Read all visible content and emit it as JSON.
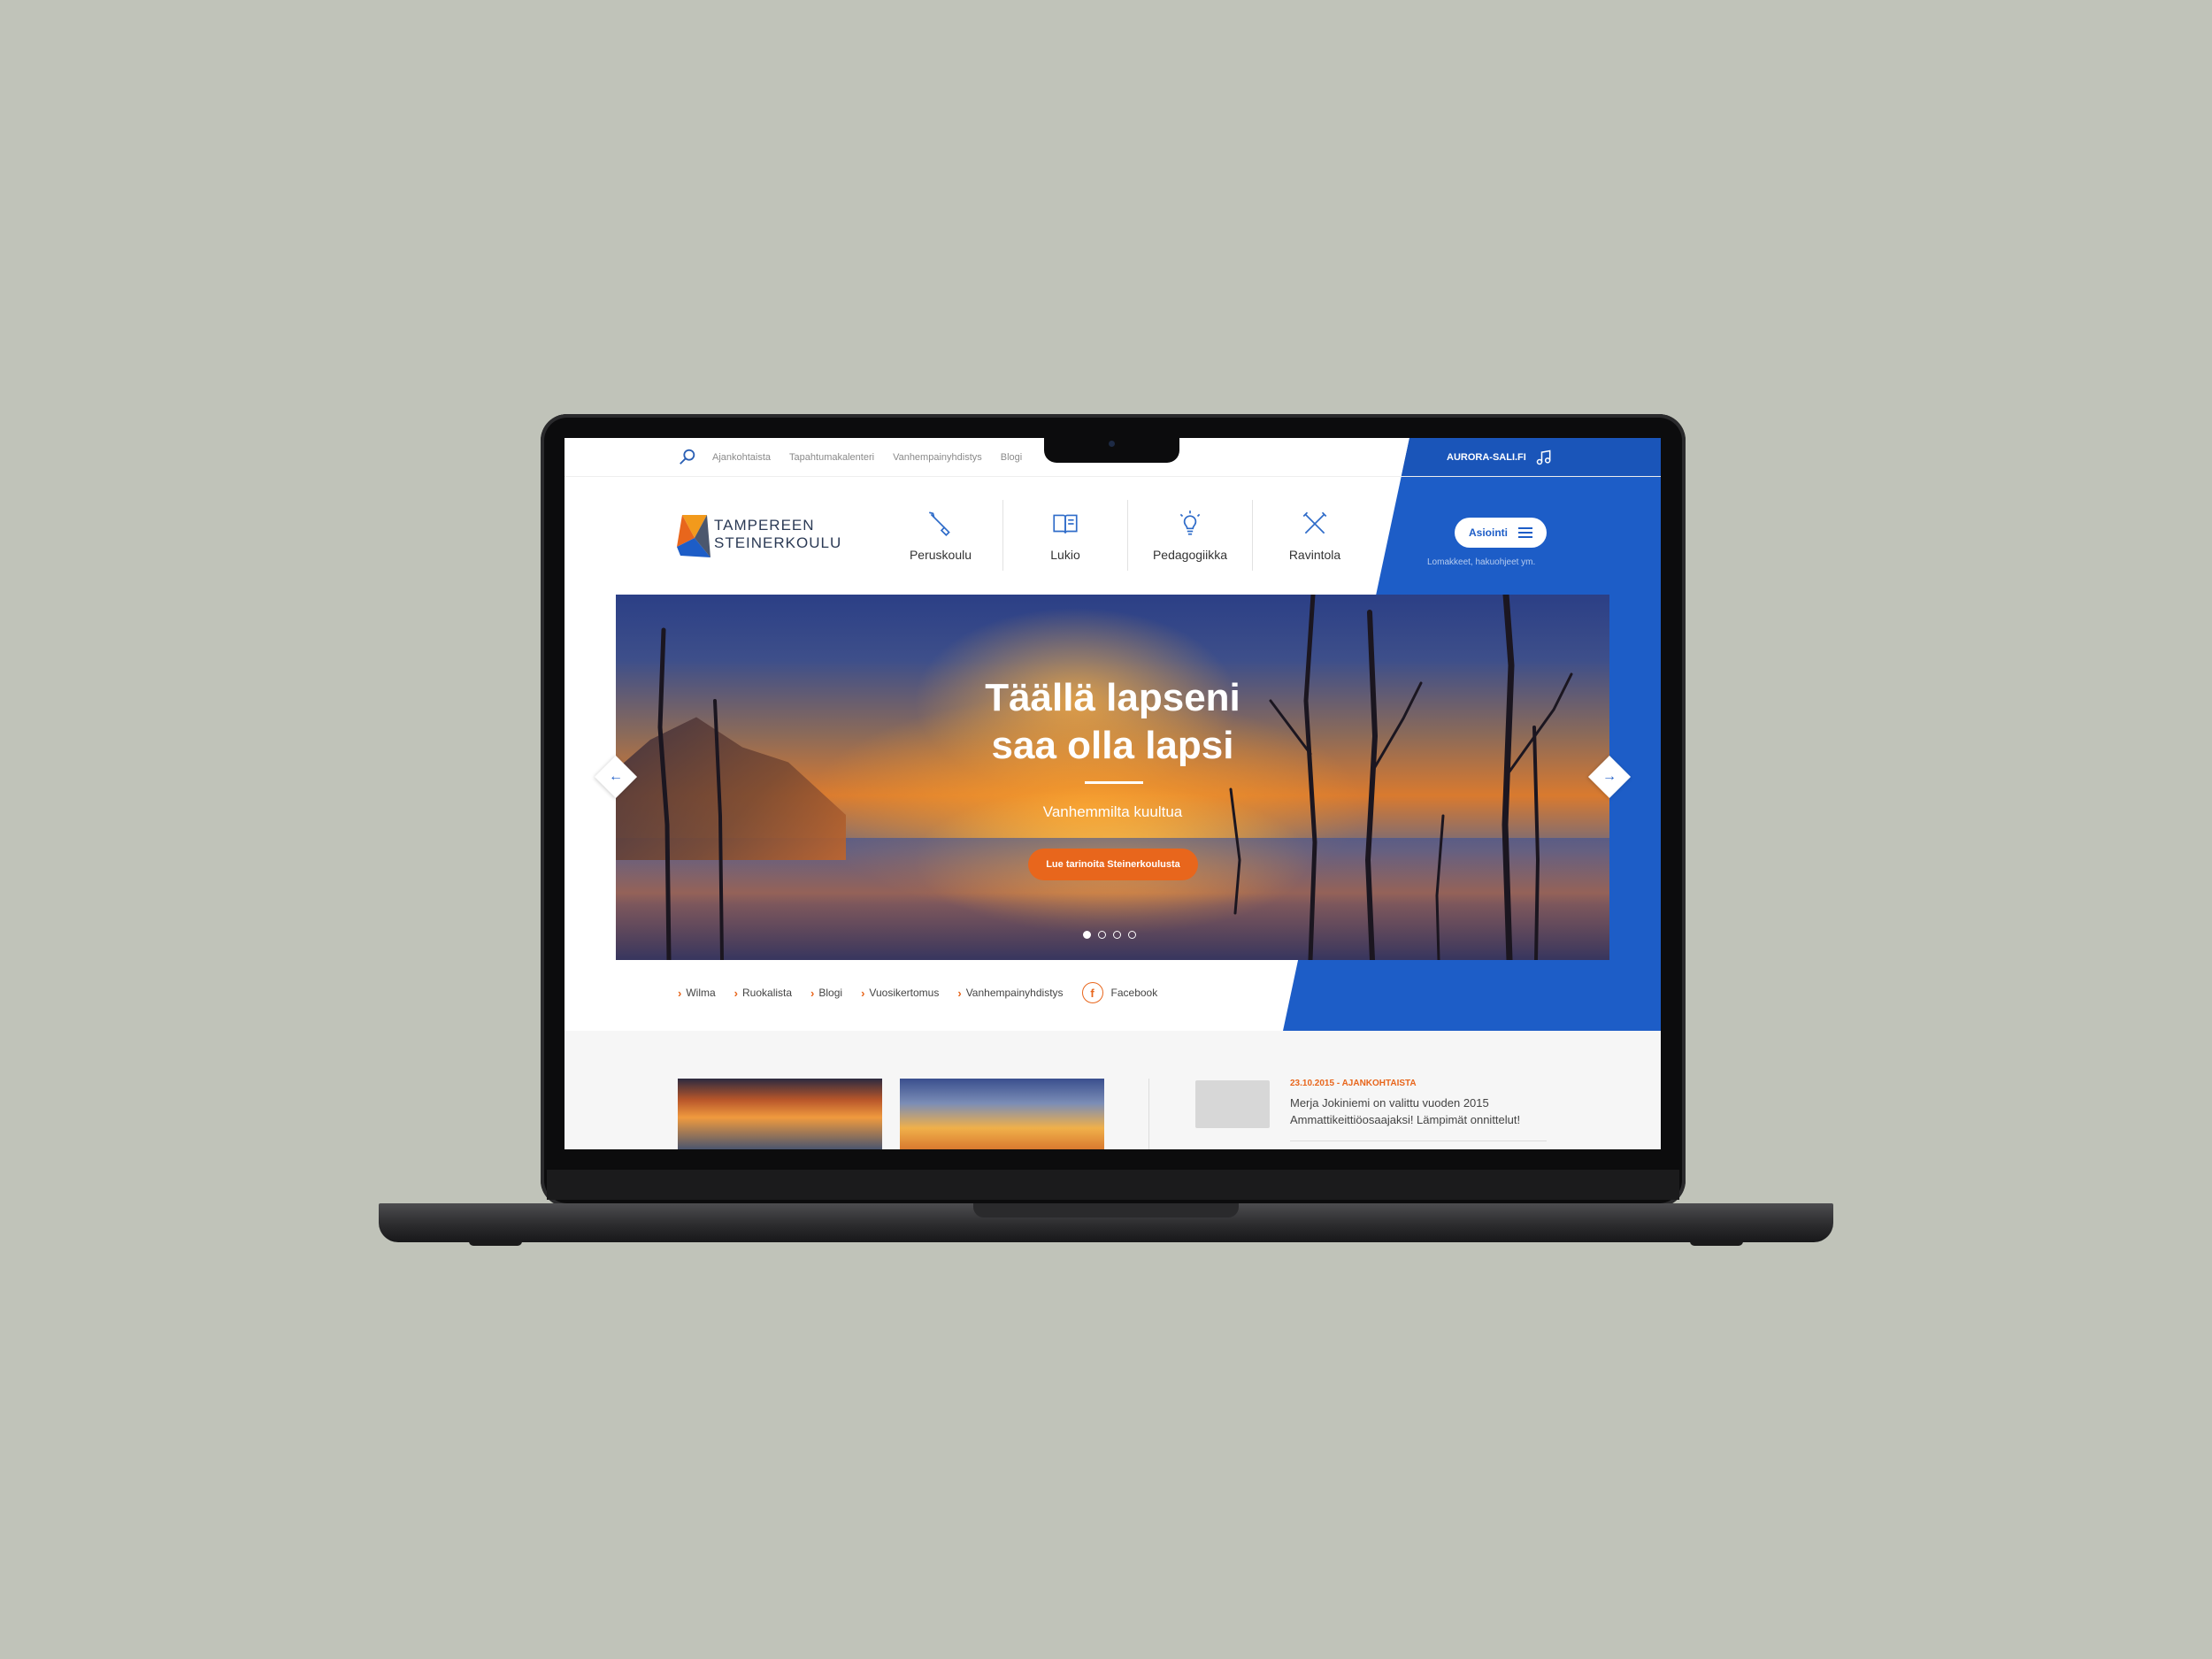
{
  "topbar": {
    "links": [
      "Ajankohtaista",
      "Tapahtumakalenteri",
      "Vanhempainyhdistys",
      "Blogi"
    ],
    "aurora_label": "AURORA-SALI.FI"
  },
  "logo": {
    "line1": "TAMPEREEN",
    "line2": "STEINERKOULU"
  },
  "mainnav": [
    {
      "label": "Peruskoulu",
      "icon": "brush-icon"
    },
    {
      "label": "Lukio",
      "icon": "book-icon"
    },
    {
      "label": "Pedagogiikka",
      "icon": "lightbulb-icon"
    },
    {
      "label": "Ravintola",
      "icon": "cutlery-icon"
    }
  ],
  "asiointi": {
    "label": "Asiointi",
    "sub": "Lomakkeet, hakuohjeet ym."
  },
  "hero": {
    "title_line1": "Täällä lapseni",
    "title_line2": "saa olla lapsi",
    "subtitle": "Vanhemmilta kuultua",
    "cta": "Lue tarinoita Steinerkoulusta",
    "slides": 4,
    "active_slide": 1
  },
  "quicklinks": [
    "Wilma",
    "Ruokalista",
    "Blogi",
    "Vuosikertomus",
    "Vanhempainyhdistys"
  ],
  "facebook_label": "Facebook",
  "news": {
    "meta": "23.10.2015 - AJANKOHTAISTA",
    "text": "Merja Jokiniemi on valittu vuoden 2015 Ammattikeittiöosaajaksi! Lämpimät onnittelut!"
  },
  "colors": {
    "brand_blue": "#1d5dc7",
    "accent_orange": "#e8661c",
    "background": "#c0c3b9"
  }
}
